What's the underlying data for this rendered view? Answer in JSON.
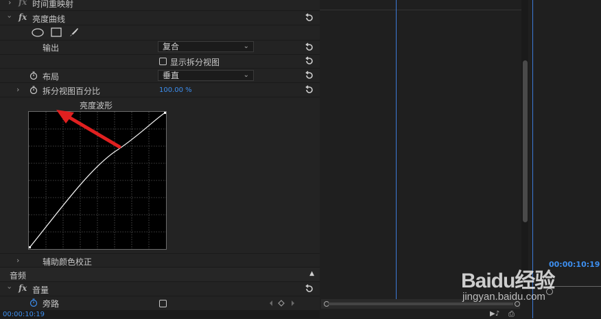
{
  "effects": {
    "time_remap": {
      "label": "时间重映射",
      "fx": "fx"
    },
    "luma_curves": {
      "label": "亮度曲线",
      "fx": "fx",
      "output_label": "输出",
      "output_value": "复合",
      "show_split_label": "显示拆分视图",
      "layout_label": "布局",
      "layout_value": "垂直",
      "split_pct_label": "拆分视图百分比",
      "split_pct_value": "100.00 %",
      "waveform_label": "亮度波形"
    },
    "secondary_color": {
      "label": "辅助颜色校正"
    }
  },
  "audio": {
    "section_label": "音频",
    "volume_label": "音量",
    "fx": "fx",
    "bypass_label": "旁路"
  },
  "timecode_bottom": "00:00:10:19",
  "timecode_right": "00:00:10:19",
  "watermark": {
    "brand": "Baidu经验",
    "url": "jingyan.baidu.com"
  },
  "icons": [
    "chevron-right-icon",
    "chevron-down-icon",
    "ellipse-mask-icon",
    "rectangle-mask-icon",
    "pen-mask-icon",
    "reset-icon",
    "stopwatch-icon",
    "checkbox-icon",
    "keyframe-nav-icon",
    "scroll-up-icon"
  ],
  "colors": {
    "accent": "#3d8ff0",
    "annotation_arrow": "#e02020"
  }
}
